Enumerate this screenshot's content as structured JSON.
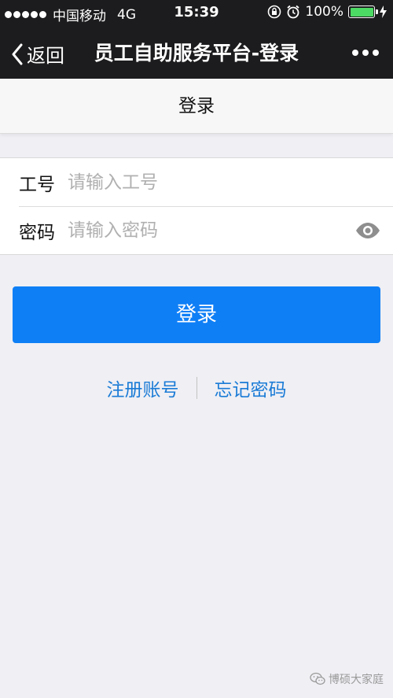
{
  "status_bar": {
    "carrier": "中国移动",
    "network": "4G",
    "time": "15:39",
    "battery": "100%",
    "battery_level": 1.0,
    "battery_color": "#4cd964"
  },
  "nav": {
    "back_label": "返回",
    "title": "员工自助服务平台-登录",
    "more_icon": "more-dots-icon"
  },
  "page": {
    "title": "登录"
  },
  "form": {
    "employee_id": {
      "label": "工号",
      "placeholder": "请输入工号",
      "value": ""
    },
    "password": {
      "label": "密码",
      "placeholder": "请输入密码",
      "value": "",
      "toggle_icon": "eye-icon"
    }
  },
  "login_button": {
    "label": "登录",
    "color": "#0f7ff6"
  },
  "links": {
    "register": "注册账号",
    "forgot": "忘记密码",
    "color": "#1a7bd6"
  },
  "watermark": {
    "text": "博硕大家庭"
  }
}
